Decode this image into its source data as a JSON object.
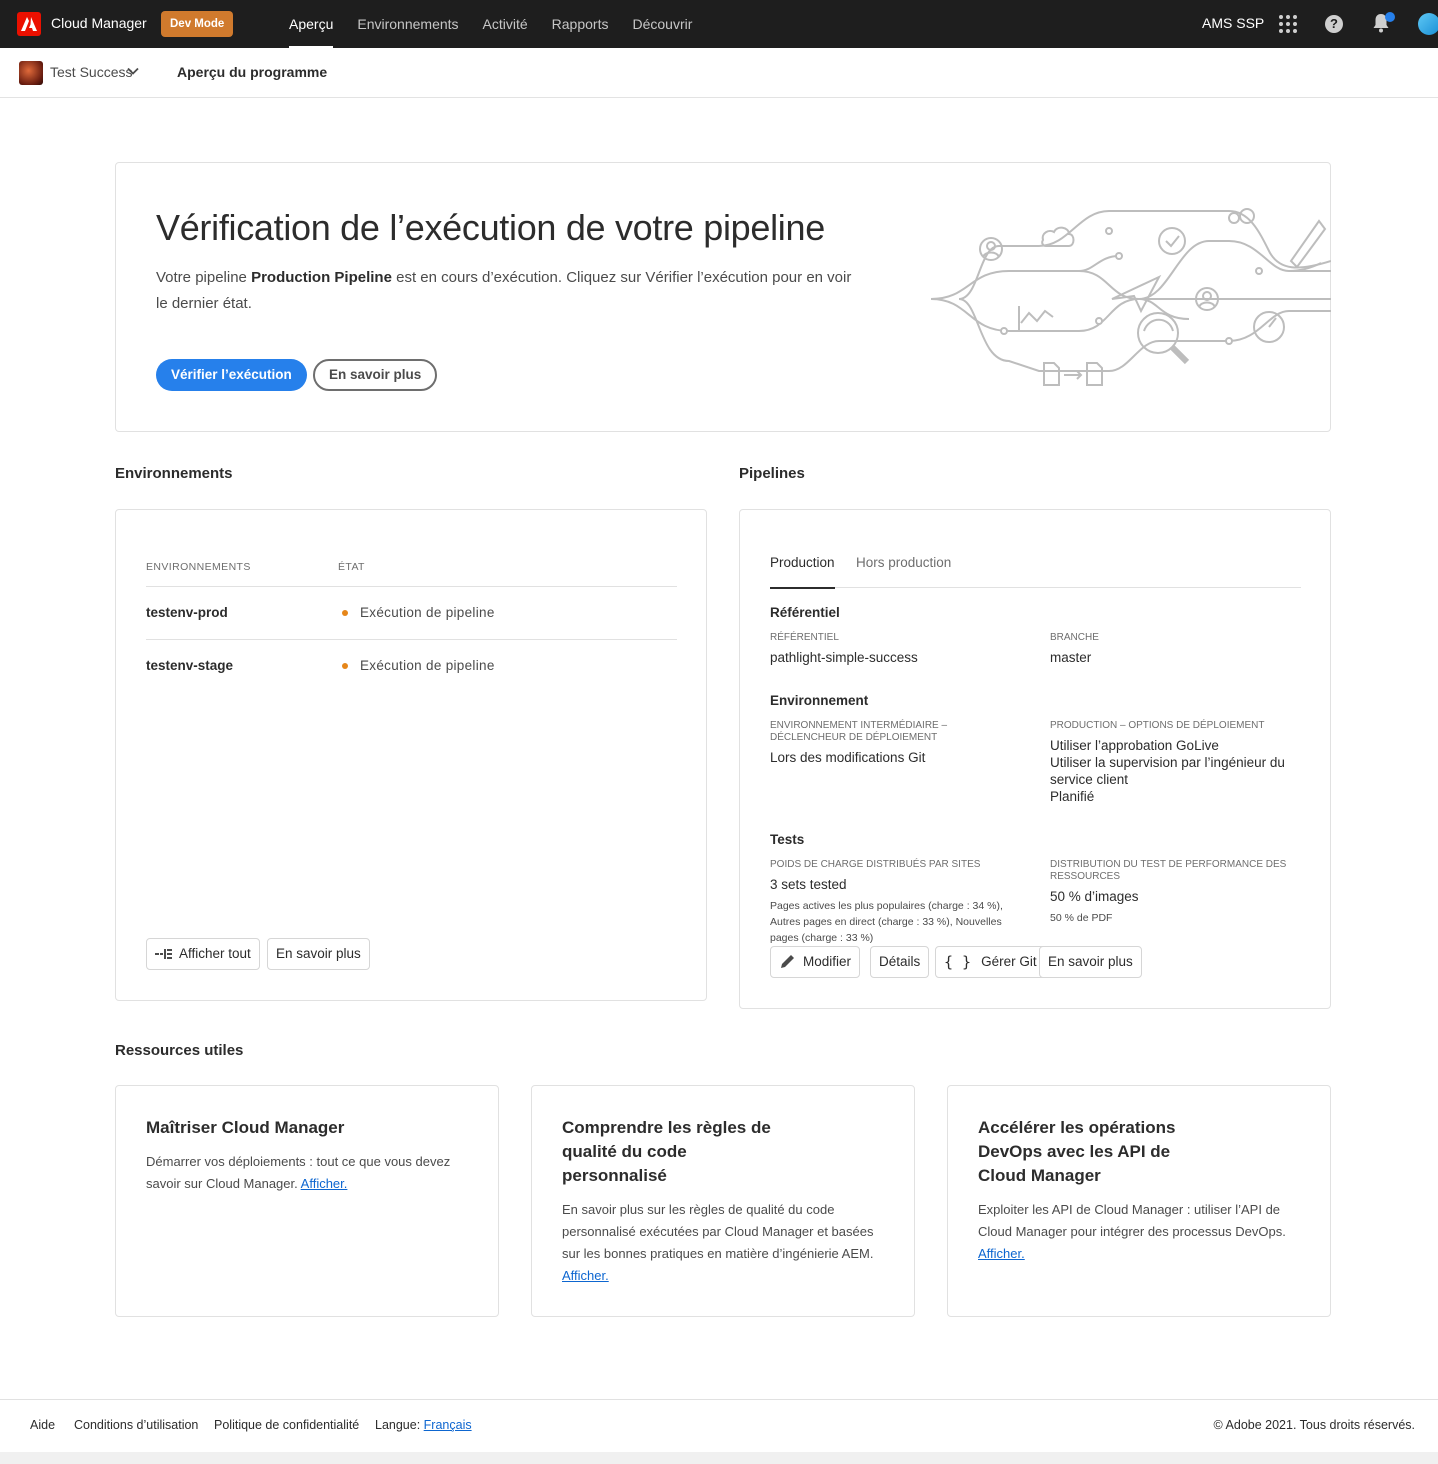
{
  "topbar": {
    "app_name": "Cloud Manager",
    "badge": "Dev Mode",
    "nav": [
      "Aperçu",
      "Environnements",
      "Activité",
      "Rapports",
      "Découvrir"
    ],
    "org": "AMS SSP"
  },
  "subbar": {
    "program": "Test Success",
    "title": "Aperçu du programme"
  },
  "hero": {
    "title": "Vérification de l’exécution de votre pipeline",
    "text_before": "Votre pipeline ",
    "text_bold": "Production Pipeline",
    "text_after": " est en cours d’exécution. Cliquez sur Vérifier l’exécution pour en voir le dernier état.",
    "primary_button": "Vérifier l’exécution",
    "secondary_button": "En savoir plus"
  },
  "environments": {
    "section_title": "Environnements",
    "col_name": "ENVIRONNEMENTS",
    "col_state": "ÉTAT",
    "rows": [
      {
        "name": "testenv-prod",
        "state": "Exécution de pipeline"
      },
      {
        "name": "testenv-stage",
        "state": "Exécution de pipeline"
      }
    ],
    "show_all": "Afficher tout",
    "learn_more": "En savoir plus"
  },
  "pipelines": {
    "section_title": "Pipelines",
    "tabs": [
      "Production",
      "Hors production"
    ],
    "repo_section": "Référentiel",
    "repo_label": "RÉFÉRENTIEL",
    "repo_value": "pathlight-simple-success",
    "branch_label": "BRANCHE",
    "branch_value": "master",
    "env_section": "Environnement",
    "stage_label": "ENVIRONNEMENT INTERMÉDIAIRE – DÉCLENCHEUR DE DÉPLOIEMENT",
    "stage_value": "Lors des modifications Git",
    "prod_label": "PRODUCTION – OPTIONS DE DÉPLOIEMENT",
    "prod_options": [
      "Utiliser l’approbation GoLive",
      "Utiliser la supervision par l’ingénieur du service client",
      "Planifié"
    ],
    "tests_section": "Tests",
    "load_label": "POIDS DE CHARGE DISTRIBUÉS PAR SITES",
    "load_value": "3 sets tested",
    "load_detail": "Pages actives les plus populaires (charge : 34 %), Autres pages en direct (charge : 33 %), Nouvelles pages (charge : 33 %)",
    "perf_label": "DISTRIBUTION DU TEST DE PERFORMANCE DES RESSOURCES",
    "perf_value": "50 % d’images",
    "perf_detail": "50 % de PDF",
    "btn_edit": "Modifier",
    "btn_details": "Détails",
    "btn_git": "Gérer Git",
    "btn_more": "En savoir plus"
  },
  "resources": {
    "section_title": "Ressources utiles",
    "link_text": "Afficher.",
    "cards": [
      {
        "title": "Maîtriser Cloud Manager",
        "text": "Démarrer vos déploiements : tout ce que vous devez savoir sur Cloud Manager."
      },
      {
        "title": "Comprendre les règles de qualité du code personnalisé",
        "text": "En savoir plus sur les règles de qualité du code personnalisé exécutées par Cloud Manager et basées sur les bonnes pratiques en matière d’ingénierie AEM."
      },
      {
        "title": "Accélérer les opérations DevOps avec les API de Cloud Manager",
        "text": "Exploiter les API de Cloud Manager : utiliser l’API de Cloud Manager pour intégrer des processus DevOps."
      }
    ]
  },
  "footer": {
    "help": "Aide",
    "terms": "Conditions d’utilisation",
    "privacy": "Politique de confidentialité",
    "language_label": "Langue:",
    "language_value": "Français",
    "copyright": "© Adobe 2021. Tous droits réservés."
  },
  "colors": {
    "accent": "#2680eb",
    "badge": "#d07a2d",
    "topbar": "#1e1e1e",
    "status_dot": "#e68619",
    "link": "#0d66d0"
  }
}
